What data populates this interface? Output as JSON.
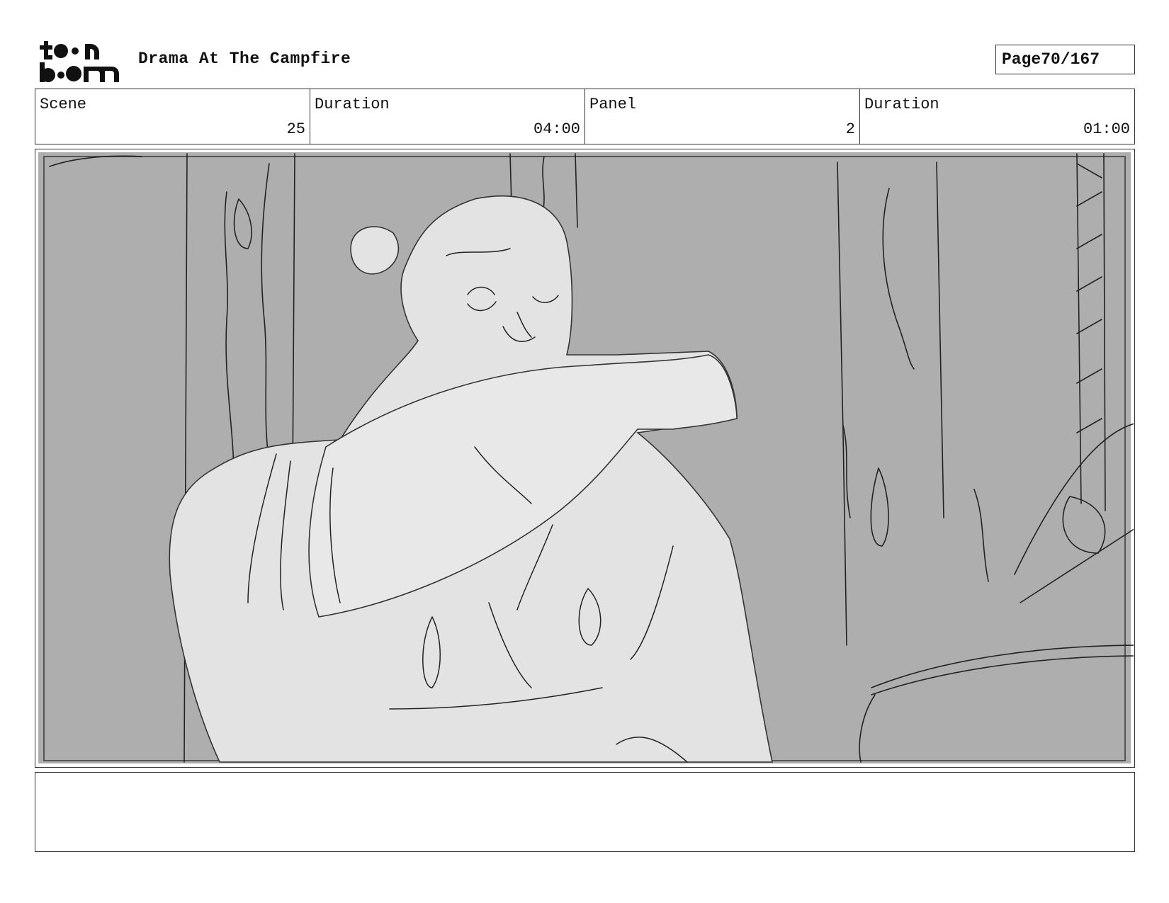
{
  "header": {
    "logo_text": "toonboom",
    "title": "Drama At The Campfire",
    "page_label": "Page",
    "page_value": "70/167"
  },
  "info": {
    "scene_label": "Scene",
    "scene_value": "25",
    "scene_duration_label": "Duration",
    "scene_duration_value": "04:00",
    "panel_label": "Panel",
    "panel_value": "2",
    "panel_duration_label": "Duration",
    "panel_duration_value": "01:00"
  },
  "notes": {
    "text": ""
  }
}
